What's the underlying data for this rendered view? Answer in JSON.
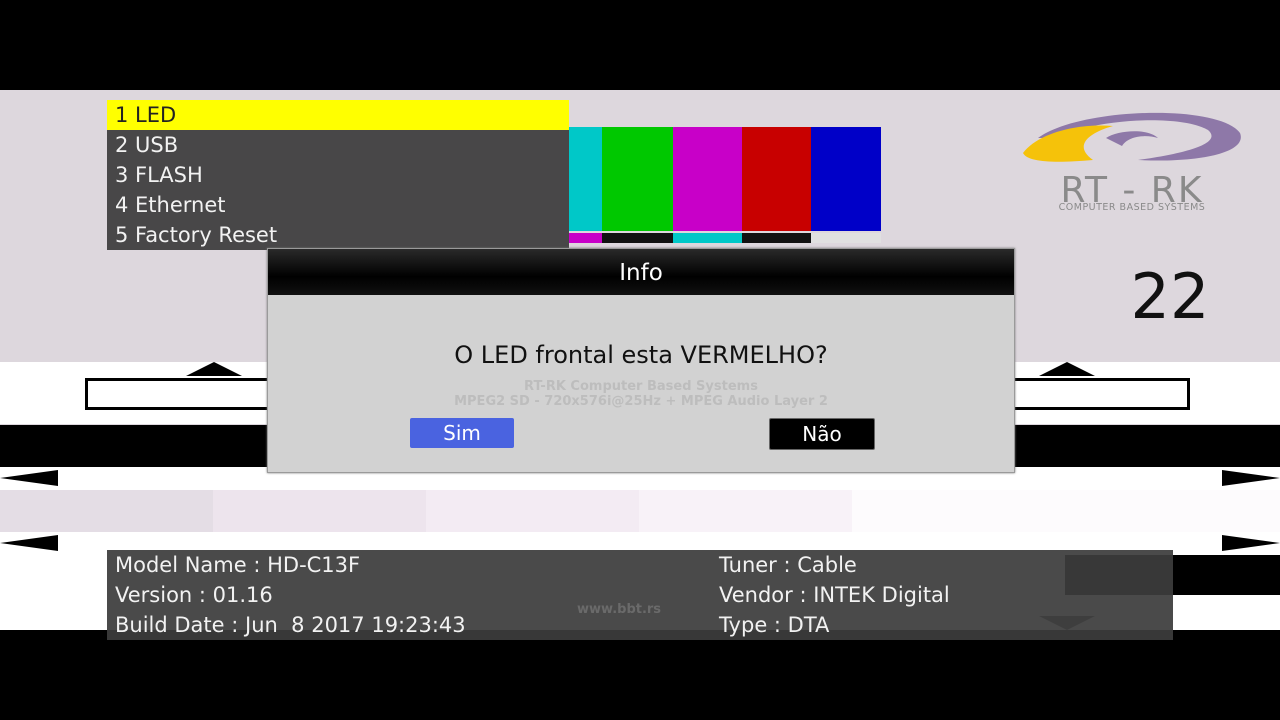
{
  "menu": {
    "items": [
      {
        "label": "1 LED"
      },
      {
        "label": "2 USB"
      },
      {
        "label": "3 FLASH"
      },
      {
        "label": "4 Ethernet"
      },
      {
        "label": "5 Factory Reset"
      }
    ],
    "selected_index": 0,
    "highlight_color": "#ffff00"
  },
  "logo": {
    "text": "RT - RK",
    "subtitle": "COMPUTER BASED SYSTEMS",
    "colors": {
      "purple": "#8e78a8",
      "yellow": "#f5c20a",
      "gray": "#8a8a8a"
    }
  },
  "channel_number": "22",
  "dialog": {
    "title": "Info",
    "message": "O LED frontal esta VERMELHO?",
    "yes_label": "Sim",
    "no_label": "Não",
    "background_text_line1": "RT-RK Computer Based Systems",
    "background_text_line2": "MPEG2 SD - 720x576i@25Hz + MPEG Audio Layer 2"
  },
  "info": {
    "model_name": "Model Name : HD-C13F",
    "version": "Version : 01.16",
    "build_date": "Build Date : Jun  8 2017 19:23:43",
    "tuner": "Tuner : Cable",
    "vendor": "Vendor : INTEK Digital",
    "type": "Type : DTA",
    "background_url_text": "www.bbt.rs"
  },
  "test_card": {
    "color_bars": [
      "#00c8c8",
      "#00c800",
      "#c800c8",
      "#c80000",
      "#0000c8"
    ],
    "accent_blue": "#4a63e0"
  }
}
